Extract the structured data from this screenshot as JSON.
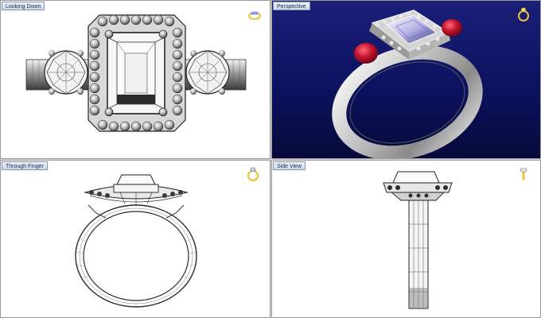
{
  "viewports": [
    {
      "title": "Looking Down",
      "icon": "ring-top-icon"
    },
    {
      "title": "Perspective",
      "icon": "ring-perspective-icon"
    },
    {
      "title": "Through Finger",
      "icon": "ring-front-icon"
    },
    {
      "title": "Side View",
      "icon": "ring-side-icon"
    }
  ],
  "colors": {
    "perspective_bg": "#0c1260",
    "metal": "#c8c8c8",
    "ruby": "#c4122e",
    "icon_gold": "#e7c23a",
    "wire": "#2a2a2a"
  }
}
